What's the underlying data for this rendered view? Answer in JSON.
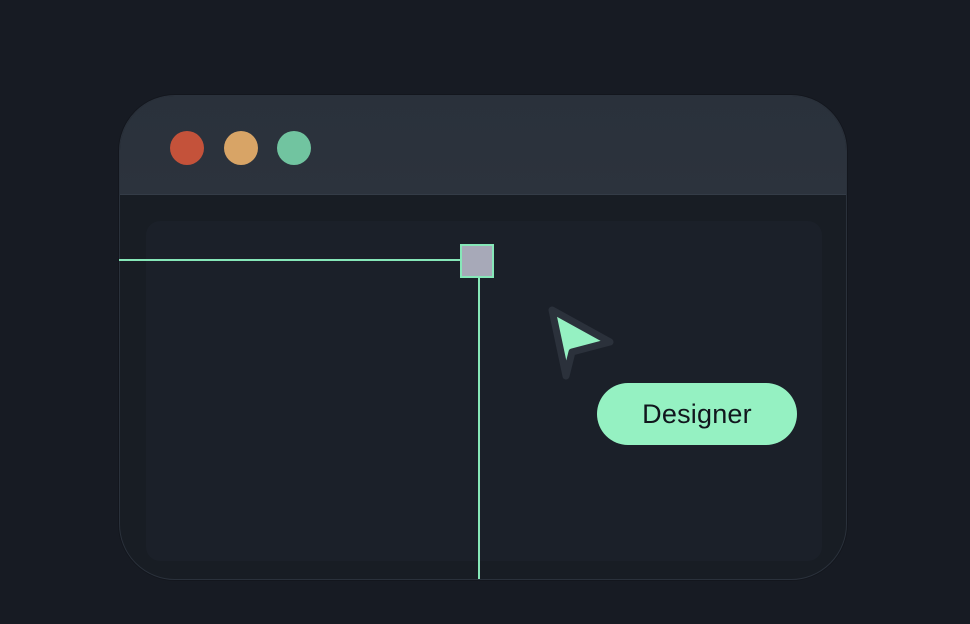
{
  "window": {
    "controls": [
      {
        "name": "close",
        "color": "#c4523a"
      },
      {
        "name": "minimize",
        "color": "#d8a466"
      },
      {
        "name": "maximize",
        "color": "#71c4a0"
      }
    ]
  },
  "selection": {
    "guide_color": "#86e7b8",
    "handle_fill": "#a7a9b8",
    "handle_border": "#86e7b8"
  },
  "cursor": {
    "icon": "pointer-cursor-icon",
    "fill": "#95f1c2",
    "outline": "#2b313b"
  },
  "collaborator": {
    "name": "Designer",
    "pill_color": "#95f1c2"
  }
}
